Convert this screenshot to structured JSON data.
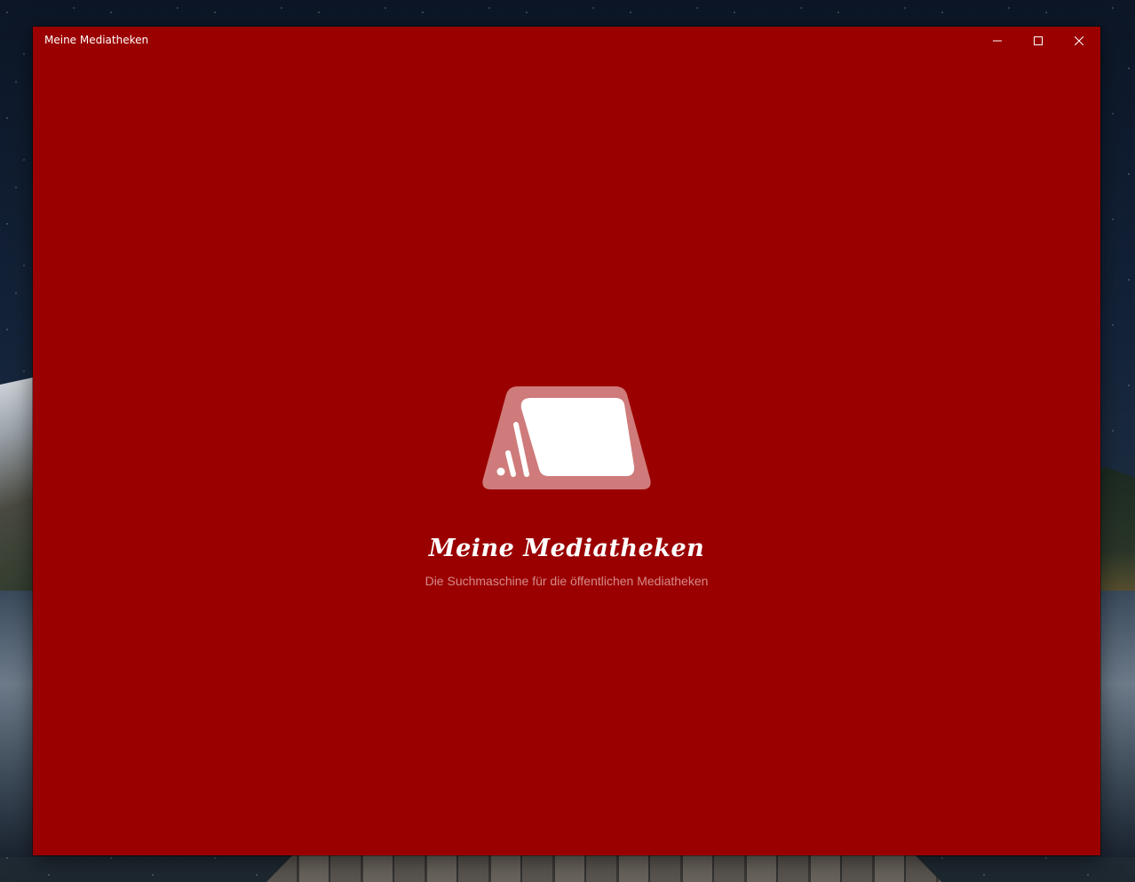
{
  "window": {
    "title": "Meine Mediatheken",
    "background_color": "#9b0000",
    "controls": {
      "minimize_icon": "minimize-icon",
      "maximize_icon": "maximize-icon",
      "close_icon": "close-icon"
    }
  },
  "splash": {
    "logo_icon": "media-tv-icon",
    "logo_colors": {
      "frame": "#cf7b7b",
      "screen": "#ffffff"
    },
    "app_name": "Meine Mediatheken",
    "tagline": "Die Suchmaschine für die öffentlichen Mediatheken"
  }
}
